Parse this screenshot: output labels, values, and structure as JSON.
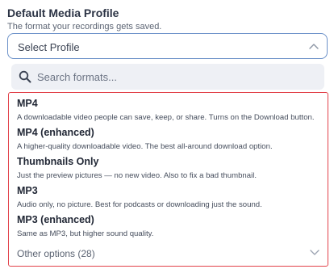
{
  "field": {
    "title": "Default Media Profile",
    "description": "The format your recordings gets saved."
  },
  "select": {
    "value": "Select Profile",
    "chevron_icon": "chevron-up-icon"
  },
  "search": {
    "placeholder": "Search formats...",
    "value": "",
    "icon": "search-icon"
  },
  "options": [
    {
      "title": "MP4",
      "description": "A downloadable video people can save, keep, or share. Turns on the Download button."
    },
    {
      "title": "MP4 (enhanced)",
      "description": "A higher-quality downloadable video. The best all-around download option."
    },
    {
      "title": "Thumbnails Only",
      "description": "Just the preview pictures — no new video. Also to fix a bad thumbnail."
    },
    {
      "title": "MP3",
      "description": "Audio only, no picture. Best for podcasts or downloading just the sound."
    },
    {
      "title": "MP3 (enhanced)",
      "description": "Same as MP3, but higher sound quality."
    }
  ],
  "other_options": {
    "label": "Other options (28)",
    "chevron_icon": "chevron-down-icon"
  },
  "colors": {
    "select_border": "#6d92c9",
    "list_border": "#e2424a",
    "search_bg": "#eef0f5"
  }
}
